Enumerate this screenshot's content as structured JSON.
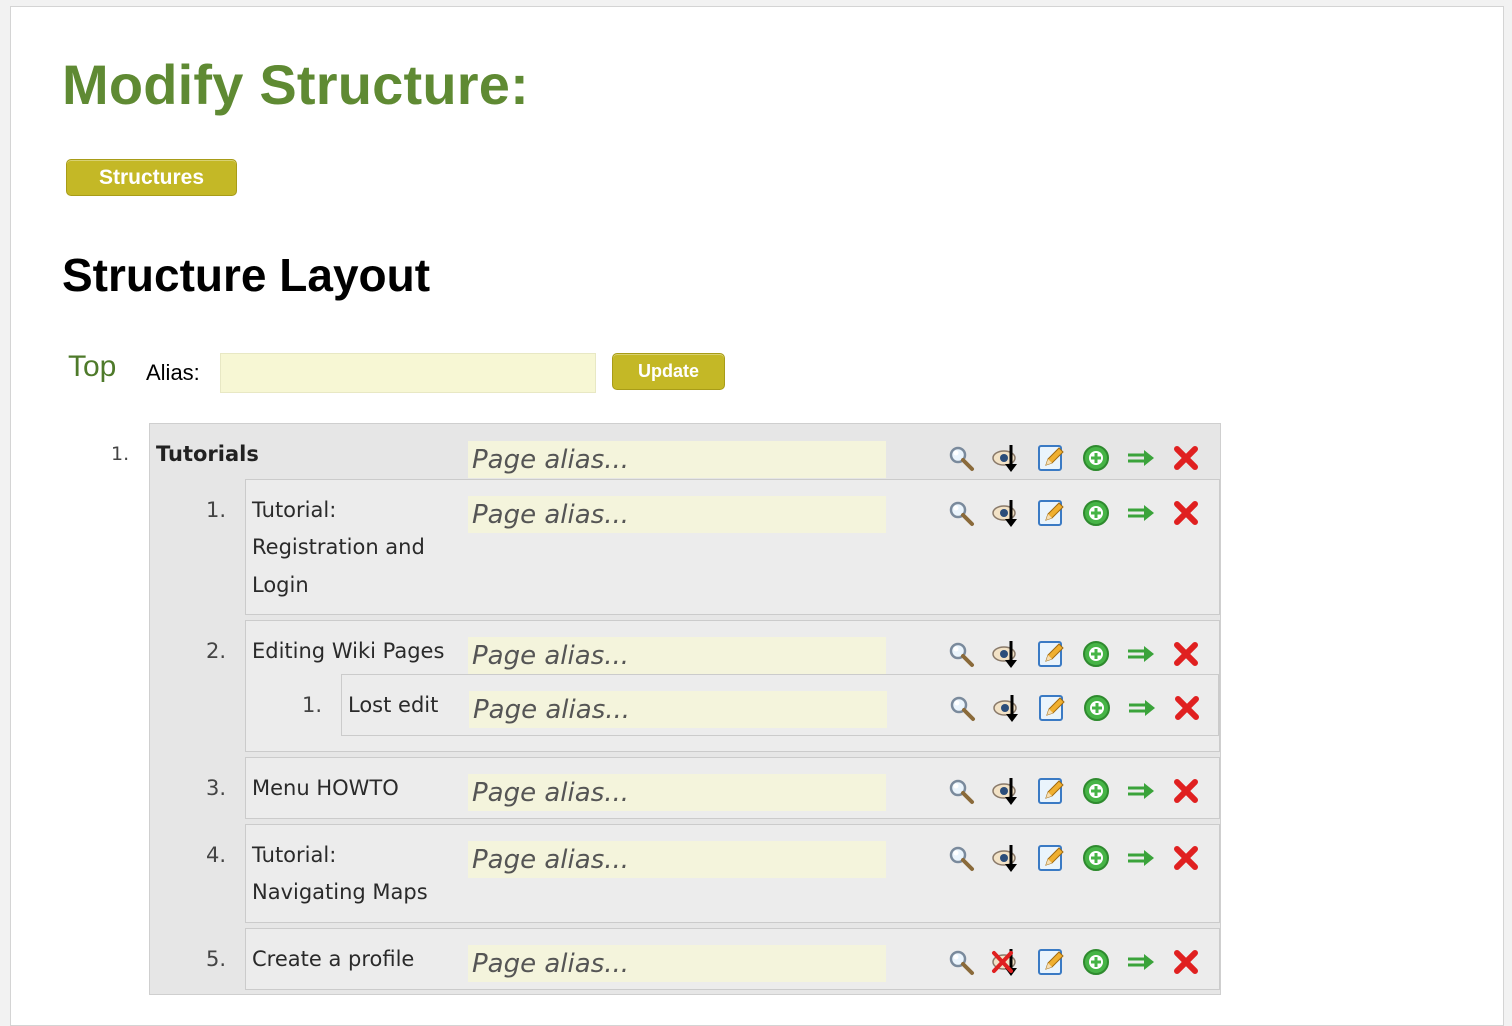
{
  "page": {
    "title": "Modify Structure:",
    "structures_button": "Structures",
    "section_title": "Structure Layout",
    "top_link": "Top",
    "alias_label": "Alias:",
    "alias_value": "",
    "update_button": "Update"
  },
  "tree": {
    "placeholder": "Page alias...",
    "icon_names": [
      "view-icon",
      "watch-icon",
      "edit-icon",
      "add-child-icon",
      "move-icon",
      "delete-icon"
    ],
    "root": {
      "number": "1.",
      "title": "Tutorials"
    },
    "items": [
      {
        "number": "1.",
        "title_lines": [
          "Tutorial:",
          "Registration and",
          "Login"
        ]
      },
      {
        "number": "2.",
        "title_lines": [
          "Editing Wiki Pages"
        ]
      },
      {
        "number": "1.",
        "title_lines": [
          "Lost edit"
        ]
      },
      {
        "number": "3.",
        "title_lines": [
          "Menu HOWTO"
        ]
      },
      {
        "number": "4.",
        "title_lines": [
          "Tutorial:",
          "Navigating Maps"
        ]
      },
      {
        "number": "5.",
        "title_lines": [
          "Create a profile"
        ]
      }
    ]
  },
  "colors": {
    "title_green": "#5f8a33",
    "button_olive": "#c4b826",
    "input_yellow": "#f7f7d4",
    "delete_red": "#e02020",
    "arrow_green": "#3aa33a"
  }
}
